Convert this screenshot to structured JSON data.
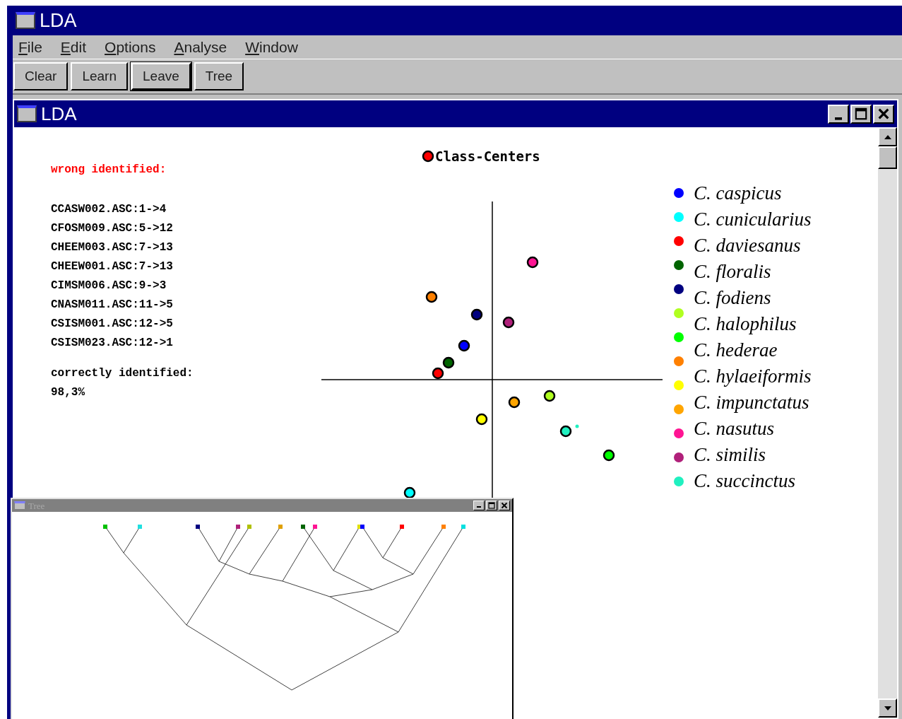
{
  "app_window": {
    "title": "LDA"
  },
  "menu": [
    {
      "label": "File"
    },
    {
      "label": "Edit"
    },
    {
      "label": "Options"
    },
    {
      "label": "Analyse"
    },
    {
      "label": "Window"
    }
  ],
  "toolbar": [
    {
      "label": "Clear",
      "default": false
    },
    {
      "label": "Learn",
      "default": false
    },
    {
      "label": "Leave",
      "default": true
    },
    {
      "label": "Tree",
      "default": false
    }
  ],
  "document_window": {
    "title": "LDA",
    "wrong_heading": "wrong identified:",
    "wrong_items": [
      "CCASW002.ASC:1->4",
      "CFOSM009.ASC:5->12",
      "CHEEM003.ASC:7->13",
      "CHEEW001.ASC:7->13",
      "CIMSM006.ASC:9->3",
      "CNASM011.ASC:11->5",
      "CSISM001.ASC:12->5",
      "CSISM023.ASC:12->1"
    ],
    "correct_heading": "correctly identified:",
    "correct_value": "98,3%",
    "plot_title": "Class-Centers",
    "legend_markers": [
      {
        "color": "#0000ff"
      },
      {
        "color": "#00ffff"
      },
      {
        "color": "#ff0000"
      },
      {
        "color": "#006400"
      },
      {
        "color": "#000080"
      },
      {
        "color": "#b0ff20"
      },
      {
        "color": "#00ff00"
      },
      {
        "color": "#ff8000"
      },
      {
        "color": "#ffff00"
      },
      {
        "color": "#ffa500"
      },
      {
        "color": "#ff1493"
      },
      {
        "color": "#b0207a"
      },
      {
        "color": "#20f0c0"
      }
    ],
    "legend_labels": [
      "C. caspicus",
      "C. cunicularius",
      "C. daviesanus",
      "C. floralis",
      "C. fodiens",
      "C. halophilus",
      "C. hederae",
      "C. hylaeiformis",
      "C. impunctatus",
      "C. nasutus",
      "C. similis",
      "C. succinctus"
    ]
  },
  "tree_window": {
    "title": "Tree",
    "active": false
  }
}
